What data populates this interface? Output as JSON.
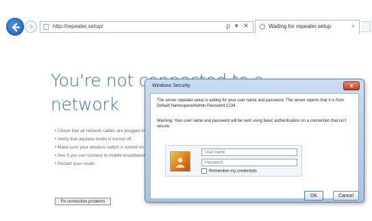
{
  "browser": {
    "address_url": "http://repeater.setup/",
    "address_tools": "ρ ▾ ✕",
    "tab_title": "Waiting for repeater.setup",
    "tab_close": "×"
  },
  "page": {
    "headline_line1": "You're not connected to a",
    "headline_line2": "network",
    "bullets": [
      "Check that all network cables are plugged in.",
      "Verify that airplane mode is turned off.",
      "Make sure your wireless switch is turned on.",
      "See if you can connect to mobile broadband.",
      "Restart your router."
    ],
    "diagnose_button": "Fix connection problems"
  },
  "dialog": {
    "title": "Windows Security",
    "close_label": "x",
    "message": "The server repeater.setup is asking for your user name and password. The server reports that it is from Default Namespace/Admin Password:1234.",
    "warning": "Warning: Your user name and password will be sent using basic authentication on a connection that isn't secure.",
    "username_placeholder": "User name",
    "password_placeholder": "Password",
    "remember_label": "Remember my credentials",
    "ok_label": "OK",
    "cancel_label": "Cancel"
  },
  "colors": {
    "headline": "#3c6fa7",
    "dialog_frame": "#a9c4e3",
    "close_button": "#c43b1f"
  }
}
